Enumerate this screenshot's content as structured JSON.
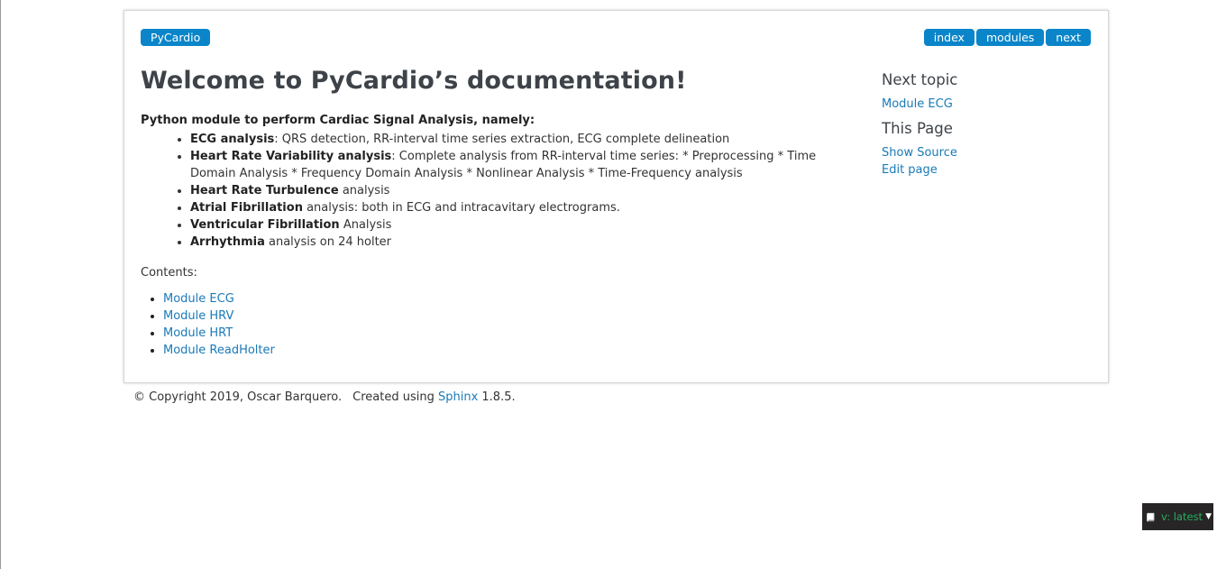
{
  "header": {
    "brand": "PyCardio",
    "nav": [
      "index",
      "modules",
      "next"
    ]
  },
  "main": {
    "title": "Welcome to PyCardio’s documentation!",
    "intro": "Python module to perform Cardiac Signal Analysis, namely:",
    "features": [
      {
        "bold": "ECG analysis",
        "text": ": QRS detection, RR-interval time series extraction, ECG complete delineation"
      },
      {
        "bold": "Heart Rate Variability analysis",
        "text": ": Complete analysis from RR-interval time series: * Preprocessing * Time Domain Analysis * Frequency Domain Analysis * Nonlinear Analysis * Time-Frequency analysis"
      },
      {
        "bold": "Heart Rate Turbulence",
        "text": " analysis"
      },
      {
        "bold": "Atrial Fibrillation",
        "text": " analysis: both in ECG and intracavitary electrograms."
      },
      {
        "bold": "Ventricular Fibrillation",
        "text": " Analysis"
      },
      {
        "bold": "Arrhythmia",
        "text": " analysis on 24 holter"
      }
    ],
    "contents_label": "Contents:",
    "toc": [
      "Module ECG",
      "Module HRV",
      "Module HRT",
      "Module ReadHolter"
    ]
  },
  "sidebar": {
    "next_topic_heading": "Next topic",
    "next_topic_link": "Module ECG",
    "this_page_heading": "This Page",
    "show_source": "Show Source",
    "edit_page": "Edit page"
  },
  "footer": {
    "copyright": "© Copyright 2019, Oscar Barquero.",
    "created_prefix": "Created using ",
    "sphinx": "Sphinx",
    "version_suffix": " 1.8.5."
  },
  "version_badge": {
    "label": "v: latest",
    "icon": "book-icon"
  },
  "colors": {
    "accent": "#0a85c9",
    "link": "#1a7ab8",
    "badge_bg": "#272525",
    "badge_text": "#27ae60"
  }
}
